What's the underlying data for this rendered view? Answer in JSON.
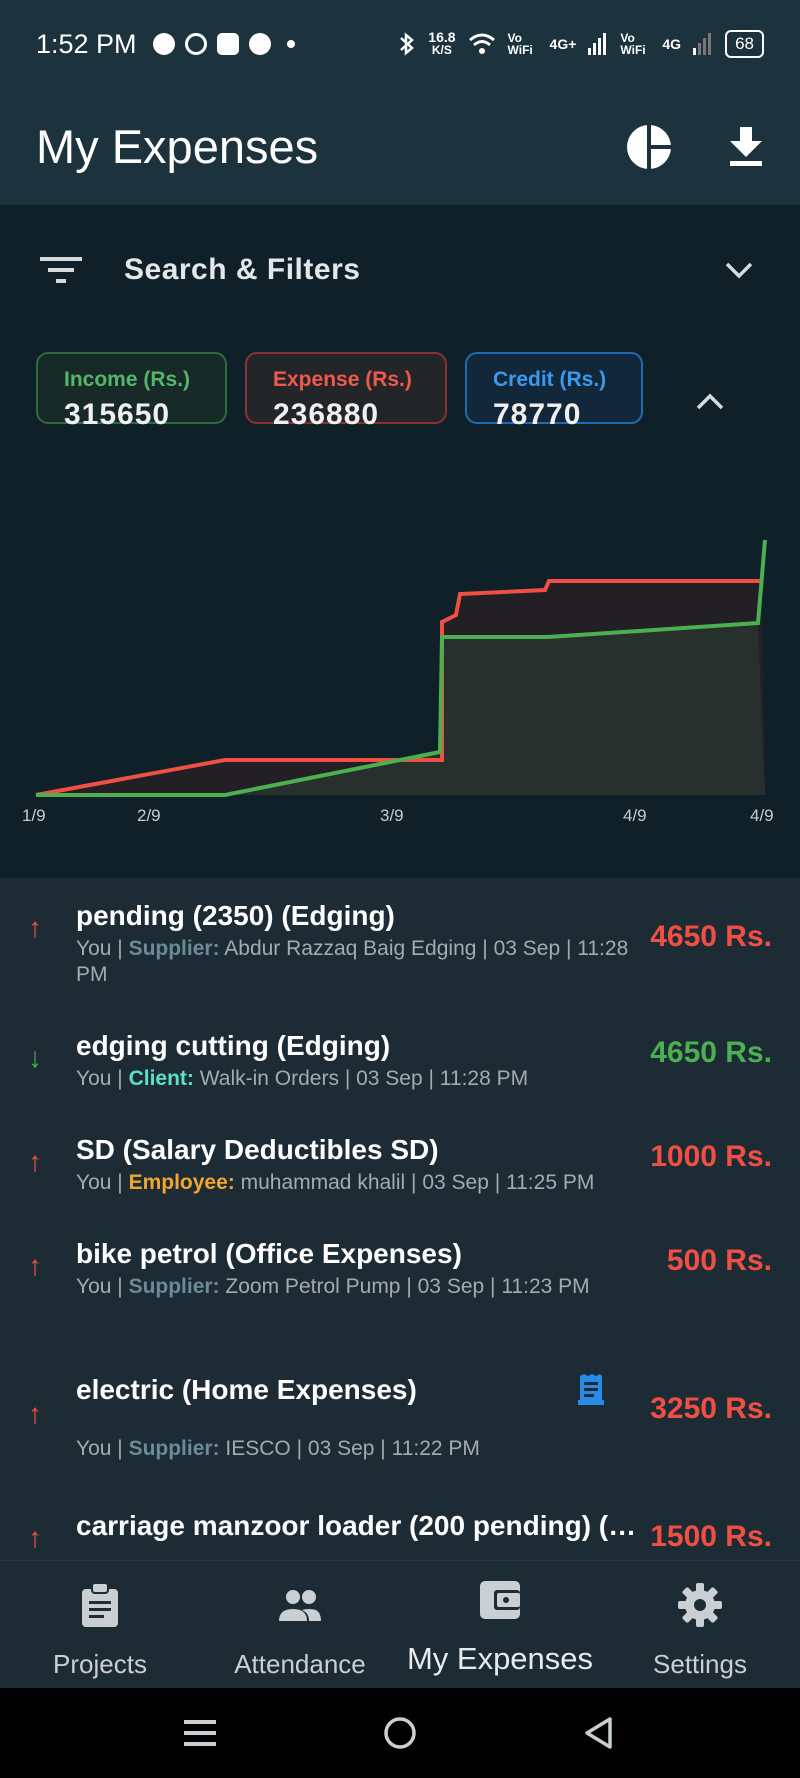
{
  "status_bar": {
    "time": "1:52 PM",
    "speed_value": "16.8",
    "speed_unit": "K/S",
    "vowifi_1": "Vo WiFi",
    "net_1": "4G+",
    "vowifi_2": "Vo WiFi",
    "net_2": "4G",
    "battery": "68"
  },
  "header": {
    "title": "My Expenses",
    "actions": [
      "pie-chart-icon",
      "download-icon"
    ]
  },
  "filters": {
    "label": "Search & Filters"
  },
  "summary": {
    "income": {
      "label": "Income (Rs.)",
      "value": "315650"
    },
    "expense": {
      "label": "Expense (Rs.)",
      "value": "236880"
    },
    "credit": {
      "label": "Credit (Rs.)",
      "value": "78770"
    }
  },
  "chart_data": {
    "type": "area",
    "x_tick_labels": [
      "1/9",
      "2/9",
      "3/9",
      "4/9",
      "4/9"
    ],
    "colors": {
      "income": "#4caf50",
      "expense": "#ef5043"
    }
  },
  "transactions": [
    {
      "direction": "expense",
      "title": "pending (2350) (Edging)",
      "who": "You",
      "role": "Supplier:",
      "party": "Abdur Razzaq Baig Edging",
      "date": "03 Sep",
      "time": "11:28 PM",
      "amount": "4650 Rs."
    },
    {
      "direction": "income",
      "title": "edging cutting (Edging)",
      "who": "You",
      "role": "Client:",
      "party": "Walk-in Orders",
      "date": "03 Sep",
      "time": "11:28 PM",
      "amount": "4650 Rs."
    },
    {
      "direction": "expense",
      "title": "SD (Salary Deductibles SD)",
      "who": "You",
      "role": "Employee:",
      "party": "muhammad khalil",
      "date": "03 Sep",
      "time": "11:25 PM",
      "amount": "1000 Rs."
    },
    {
      "direction": "expense",
      "title": "bike petrol (Office Expenses)",
      "who": "You",
      "role": "Supplier:",
      "party": "Zoom Petrol Pump",
      "date": "03 Sep",
      "time": "11:23 PM",
      "amount": "500 Rs."
    },
    {
      "direction": "expense",
      "title": "electric (Home Expenses)",
      "who": "You",
      "role": "Supplier:",
      "party": "IESCO",
      "date": "03 Sep",
      "time": "11:22 PM",
      "amount": "3250 Rs.",
      "has_receipt": true
    },
    {
      "direction": "expense",
      "title": "carriage manzoor loader (200 pending) (…",
      "amount": "1500 Rs."
    }
  ],
  "bottom_nav": [
    {
      "label": "Projects",
      "icon": "clipboard-icon"
    },
    {
      "label": "Attendance",
      "icon": "people-icon"
    },
    {
      "label": "My Expenses",
      "icon": "wallet-icon",
      "active": true
    },
    {
      "label": "Settings",
      "icon": "gear-icon"
    }
  ]
}
